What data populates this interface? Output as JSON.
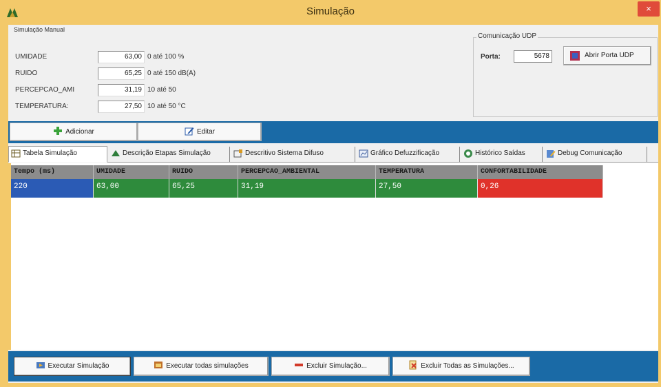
{
  "window": {
    "title": "Simulação",
    "close_glyph": "×",
    "app_icon": "app-logo-icon",
    "colors": {
      "frame": "#f3c96a",
      "bar": "#1a6aa6",
      "close": "#e04b3a"
    }
  },
  "manual": {
    "legend": "Simulação Manual",
    "params": [
      {
        "label": "UMIDADE",
        "value": "63,00",
        "range": "0 até 100 %"
      },
      {
        "label": "RUIDO",
        "value": "65,25",
        "range": "0 até 150 dB(A)"
      },
      {
        "label": "PERCEPCAO_AMI",
        "value": "31,19",
        "range": "10 até 50"
      },
      {
        "label": "TEMPERATURA:",
        "value": "27,50",
        "range": "10 até 50 °C"
      }
    ]
  },
  "udp": {
    "legend": "Comunicação UDP",
    "port_label": "Porta:",
    "port_value": "5678",
    "open_label": "Abrir Porta UDP"
  },
  "actions": {
    "add_label": "Adicionar",
    "edit_label": "Editar"
  },
  "tabs": [
    {
      "label": "Tabela Simulação",
      "icon": "table-icon"
    },
    {
      "label": "Descrição Etapas Simulação",
      "icon": "steps-icon"
    },
    {
      "label": "Descritivo Sistema Difuso",
      "icon": "fuzzy-system-icon"
    },
    {
      "label": "Gráfico Defuzzificação",
      "icon": "chart-icon"
    },
    {
      "label": "Histórico Saídas",
      "icon": "history-icon"
    },
    {
      "label": "Debug Comunicação",
      "icon": "debug-icon"
    }
  ],
  "table": {
    "columns": [
      "Tempo (ms)",
      "UMIDADE",
      "RUIDO",
      "PERCEPCAO_AMBIENTAL",
      "TEMPERATURA",
      "CONFORTABILIDADE"
    ],
    "rows": [
      {
        "cells": [
          "220",
          "63,00",
          "65,25",
          "31,19",
          "27,50",
          "0,26"
        ],
        "colors": [
          "#2b5bb5",
          "#2e8b3c",
          "#2e8b3c",
          "#2e8b3c",
          "#2e8b3c",
          "#e0322a"
        ]
      }
    ]
  },
  "bottom_buttons": [
    {
      "label": "Executar Simulação",
      "icon": "run-icon"
    },
    {
      "label": "Executar todas simulações",
      "icon": "run-all-icon"
    },
    {
      "label": "Excluir Simulação...",
      "icon": "delete-icon"
    },
    {
      "label": "Excluir Todas as Simulações...",
      "icon": "delete-all-icon"
    }
  ]
}
